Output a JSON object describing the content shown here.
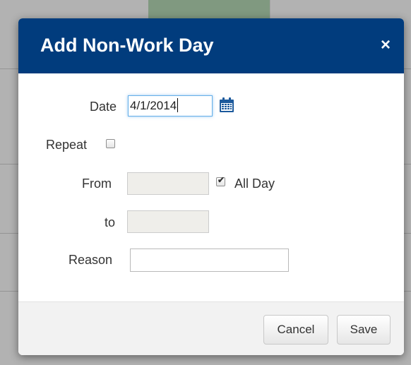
{
  "dialog": {
    "title": "Add Non-Work Day",
    "close_symbol": "×"
  },
  "form": {
    "date_label": "Date",
    "date_value": "4/1/2014",
    "calendar_icon": "calendar-icon",
    "repeat_label": "Repeat",
    "repeat_checked": false,
    "from_label": "From",
    "all_day_label": "All Day",
    "all_day_checked": true,
    "to_label": "to",
    "reason_label": "Reason",
    "reason_value": ""
  },
  "footer": {
    "cancel_label": "Cancel",
    "save_label": "Save"
  },
  "colors": {
    "header_bg": "#013c7d",
    "focus_border": "#66afe9",
    "calendar_icon": "#1d5a9c"
  }
}
